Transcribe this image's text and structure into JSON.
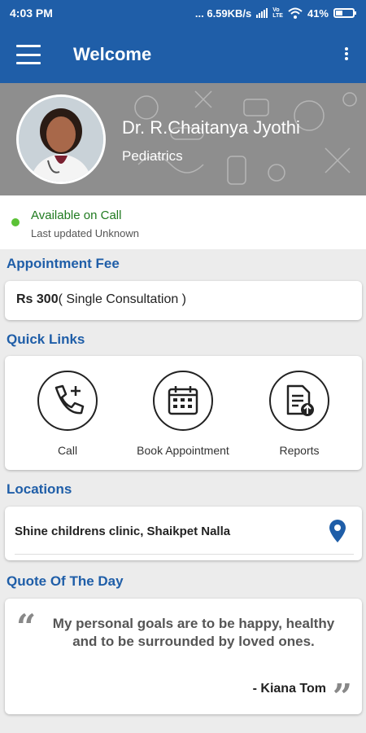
{
  "status_bar": {
    "time": "4:03 PM",
    "network_speed": "... 6.59KB/s",
    "battery_percent": "41%",
    "battery_level": 0.41
  },
  "app_bar": {
    "title": "Welcome"
  },
  "profile": {
    "name": "Dr. R.Chaitanya Jyothi",
    "specialty": "Pediatrics"
  },
  "availability": {
    "status": "Available on Call",
    "updated": "Last updated Unknown",
    "status_color": "#5bc236"
  },
  "fee": {
    "section_title": "Appointment Fee",
    "amount": "Rs 300",
    "description": "( Single Consultation )"
  },
  "quick_links": {
    "section_title": "Quick Links",
    "items": [
      {
        "label": "Call",
        "icon": "phone-plus-icon"
      },
      {
        "label": "Book Appointment",
        "icon": "calendar-icon"
      },
      {
        "label": "Reports",
        "icon": "report-upload-icon"
      }
    ]
  },
  "locations": {
    "section_title": "Locations",
    "items": [
      {
        "name": "Shine childrens clinic, Shaikpet Nalla",
        "icon": "map-pin-icon"
      }
    ]
  },
  "quote": {
    "section_title": "Quote Of The Day",
    "text": "My personal goals are to be happy, healthy and to be surrounded by loved ones.",
    "author": "- Kiana Tom"
  },
  "colors": {
    "primary": "#1f5ea8",
    "available": "#1f7a1f"
  }
}
